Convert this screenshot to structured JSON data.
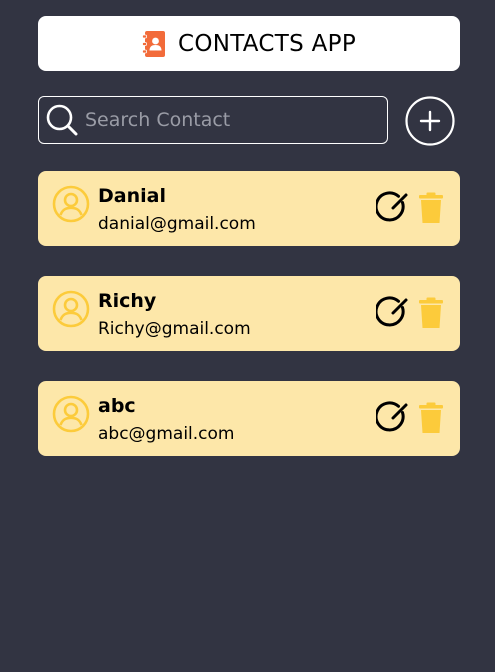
{
  "header": {
    "title": "CONTACTS APP",
    "logo_icon": "address-book-icon",
    "logo_color": "#f26b3a"
  },
  "search": {
    "placeholder": "Search Contact",
    "value": "",
    "icon": "search-icon"
  },
  "add_button": {
    "icon": "plus-circle-icon"
  },
  "colors": {
    "background": "#323442",
    "card": "#fde7a9",
    "accent_yellow": "#fccb3b"
  },
  "contacts": [
    {
      "name": "Danial",
      "email": "danial@gmail.com"
    },
    {
      "name": "Richy",
      "email": "Richy@gmail.com"
    },
    {
      "name": "abc",
      "email": "abc@gmail.com"
    }
  ]
}
